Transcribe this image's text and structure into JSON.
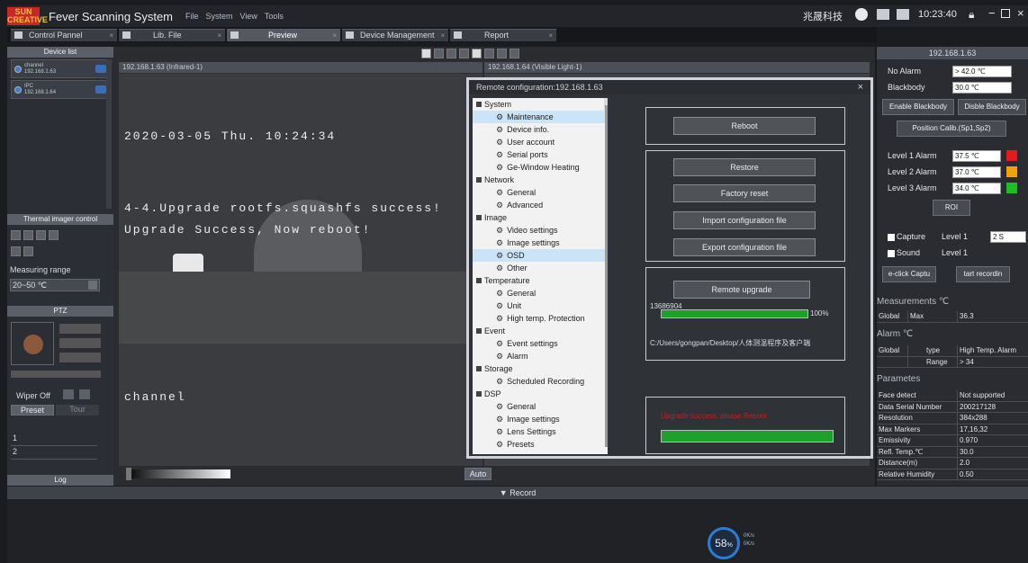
{
  "app": {
    "logo": "SUN CREATIVE",
    "title": "Fever Scanning System",
    "menus": [
      "File",
      "System",
      "View",
      "Tools"
    ],
    "tray_text": "兆晟科技",
    "clock": "10:23:40"
  },
  "tabs": [
    "Control Pannel",
    "Lib. File",
    "Preview",
    "Device Management",
    "Report"
  ],
  "left": {
    "device_list_title": "Device list",
    "devices": [
      {
        "name": "channel",
        "ip": "192.168.1.63"
      },
      {
        "name": "IPC",
        "ip": "192.168.1.64"
      }
    ],
    "thermal_title": "Thermal imager control",
    "measuring_range_label": "Measuring range",
    "measuring_range_value": "20~50 ℃",
    "ptz_title": "PTZ",
    "wiper_label": "Wiper Off",
    "preset_tab": "Preset",
    "tour_tab": "Tour",
    "preset_rows": [
      "1",
      "2"
    ],
    "log_title": "Log"
  },
  "video": {
    "left_title": "192.168.1.63 (Infrared-1)",
    "right_title": "192.168.1.64 (Visible Light-1)",
    "osd_datetime": "2020-03-05 Thu. 10:24:34",
    "osd_line1": "4-4.Upgrade rootfs.squashfs success!",
    "osd_line2": "Upgrade Success, Now reboot!",
    "osd_channel": "channel",
    "auto_button": "Auto"
  },
  "dialog": {
    "title": "Remote configuration:192.168.1.63",
    "close": "×",
    "tree": [
      {
        "t": "g",
        "label": "System"
      },
      {
        "t": "c",
        "label": "Maintenance",
        "sel": true
      },
      {
        "t": "c",
        "label": "Device info."
      },
      {
        "t": "c",
        "label": "User account"
      },
      {
        "t": "c",
        "label": "Serial ports"
      },
      {
        "t": "c",
        "label": "Ge-Window Heating"
      },
      {
        "t": "g",
        "label": "Network"
      },
      {
        "t": "c",
        "label": "General"
      },
      {
        "t": "c",
        "label": "Advanced"
      },
      {
        "t": "g",
        "label": "Image"
      },
      {
        "t": "c",
        "label": "Video settings"
      },
      {
        "t": "c",
        "label": "Image settings"
      },
      {
        "t": "c",
        "label": "OSD",
        "sel": true
      },
      {
        "t": "c",
        "label": "Other"
      },
      {
        "t": "g",
        "label": "Temperature"
      },
      {
        "t": "c",
        "label": "General"
      },
      {
        "t": "c",
        "label": "Unit"
      },
      {
        "t": "c",
        "label": "High temp. Protection"
      },
      {
        "t": "g",
        "label": "Event"
      },
      {
        "t": "c",
        "label": "Event settings"
      },
      {
        "t": "c",
        "label": "Alarm"
      },
      {
        "t": "g",
        "label": "Storage"
      },
      {
        "t": "c",
        "label": "Scheduled Recording"
      },
      {
        "t": "g",
        "label": "DSP"
      },
      {
        "t": "c",
        "label": "General"
      },
      {
        "t": "c",
        "label": "Image settings"
      },
      {
        "t": "c",
        "label": "Lens Settings"
      },
      {
        "t": "c",
        "label": "Presets"
      }
    ],
    "reboot": "Reboot",
    "restore": "Restore",
    "factory_reset": "Factory reset",
    "import_cfg": "Import configuration file",
    "export_cfg": "Export configuration file",
    "remote_upgrade": "Remote upgrade",
    "upgrade_bytes": "13686904",
    "upgrade_progress": 1.0,
    "upgrade_percent": "100%",
    "upgrade_path": "C:/Users/gongpan/Desktop/人体测温程序及客户端",
    "status_text": "Upgrade success, please Reboot",
    "status_progress": 1.0
  },
  "right": {
    "ip_title": "192.168.1.63",
    "no_alarm_label": "No Alarm",
    "no_alarm_value": "> 42.0 ℃",
    "blackbody_label": "Blackbody",
    "blackbody_value": "30.0 ℃",
    "enable_blackbody": "Enable Blackbody",
    "disable_blackbody": "Disble Blackbody",
    "position_calib": "Position Calib.(Sp1,Sp2)",
    "alarms": [
      {
        "label": "Level 1 Alarm",
        "value": "37.5 ℃",
        "color": "#e21b1b"
      },
      {
        "label": "Level 2 Alarm",
        "value": "37.0 ℃",
        "color": "#f2a20c"
      },
      {
        "label": "Level 3 Alarm",
        "value": "34.0 ℃",
        "color": "#18c21a"
      }
    ],
    "roi": "ROI",
    "capture_label": "Capture",
    "capture_level": "Level 1",
    "capture_value": "2 S",
    "sound_label": "Sound",
    "sound_level": "Level 1",
    "one_click_capture": "e-click Captu",
    "start_recording": "tart recordin",
    "measurements_title": "Measurements ℃",
    "measurements": [
      "Global",
      "Max",
      "36.3"
    ],
    "alarm_title": "Alarm ℃",
    "alarm_row1": [
      "Global",
      "type",
      "High Temp. Alarm"
    ],
    "alarm_row2": [
      "",
      "Range",
      "> 34"
    ],
    "params_title": "Parametes",
    "params": [
      [
        "Face detect",
        "Not supported"
      ],
      [
        "Data Serial Number",
        "200217128"
      ],
      [
        "Resolution",
        "384x288"
      ],
      [
        "Max Markers",
        "17,16,32"
      ],
      [
        "Emissivity",
        "0.970"
      ],
      [
        "Refl. Temp.℃",
        "30.0"
      ],
      [
        "Distance(m)",
        "2.0"
      ],
      [
        "Relative Humidity",
        "0.50"
      ]
    ]
  },
  "record_bar": "▼ Record",
  "gauge_value": "58",
  "gauge_unit": "%",
  "gauge_side": [
    "0K/s",
    "0K/s"
  ]
}
